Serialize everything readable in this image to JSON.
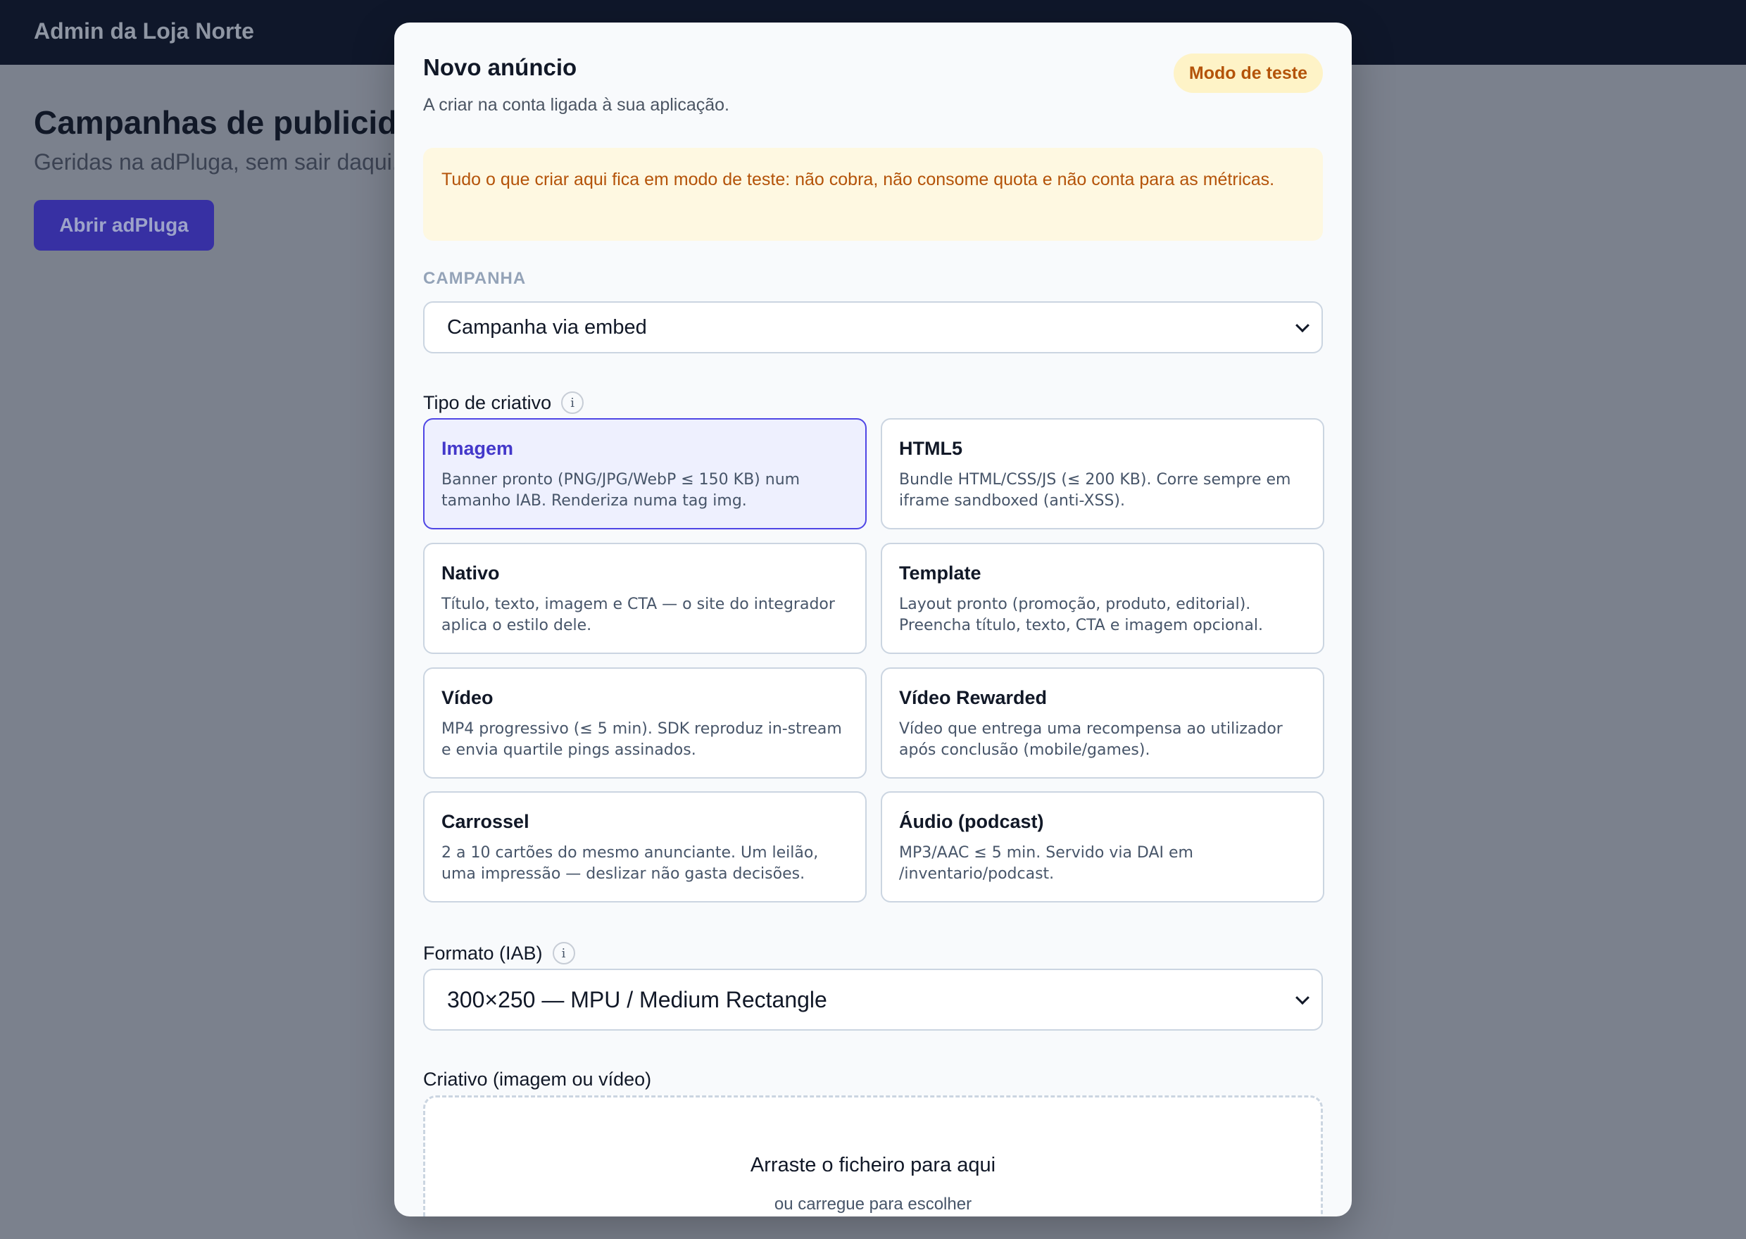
{
  "app": {
    "brand": "Admin da Loja Norte",
    "heading": "Campanhas de publicidade",
    "subheading": "Geridas na adPluga, sem sair daqui.",
    "open_button": "Abrir adPluga"
  },
  "modal": {
    "title": "Novo anúncio",
    "description": "A criar na conta ligada à sua aplicação.",
    "test_badge": "Modo de teste",
    "notice": "Tudo o que criar aqui fica em modo de teste: não cobra, não consome quota e não conta para as métricas.",
    "campaign_label": "CAMPANHA",
    "campaign_value": "Campanha via embed",
    "creative_type_label": "Tipo de criativo",
    "creative_types": [
      {
        "title": "Imagem",
        "desc": "Banner pronto (PNG/JPG/WebP ≤ 150 KB) num tamanho IAB. Renderiza numa tag img.",
        "selected": true
      },
      {
        "title": "HTML5",
        "desc": "Bundle HTML/CSS/JS (≤ 200 KB). Corre sempre em iframe sandboxed (anti-XSS).",
        "selected": false
      },
      {
        "title": "Nativo",
        "desc": "Título, texto, imagem e CTA — o site do integrador aplica o estilo dele.",
        "selected": false
      },
      {
        "title": "Template",
        "desc": "Layout pronto (promoção, produto, editorial). Preencha título, texto, CTA e imagem opcional.",
        "selected": false
      },
      {
        "title": "Vídeo",
        "desc": "MP4 progressivo (≤ 5 min). SDK reproduz in-stream e envia quartile pings assinados.",
        "selected": false
      },
      {
        "title": "Vídeo Rewarded",
        "desc": "Vídeo que entrega uma recompensa ao utilizador após conclusão (mobile/games).",
        "selected": false
      },
      {
        "title": "Carrossel",
        "desc": "2 a 10 cartões do mesmo anunciante. Um leilão, uma impressão — deslizar não gasta decisões.",
        "selected": false
      },
      {
        "title": "Áudio (podcast)",
        "desc": "MP3/AAC ≤ 5 min. Servido via DAI em /inventario/podcast.",
        "selected": false
      }
    ],
    "format_label": "Formato (IAB)",
    "format_value": "300×250 — MPU / Medium Rectangle",
    "creative_label": "Criativo (imagem ou vídeo)",
    "dropzone_title": "Arraste o ficheiro para aqui",
    "dropzone_sub": "ou carregue para escolher"
  },
  "icons": {
    "info": "info-icon",
    "chevron": "chevron-down-icon"
  },
  "colors": {
    "accent": "#4f46e5",
    "topbar": "#0f172a",
    "warning_bg": "#fef3c7",
    "warning_text": "#b45309"
  }
}
